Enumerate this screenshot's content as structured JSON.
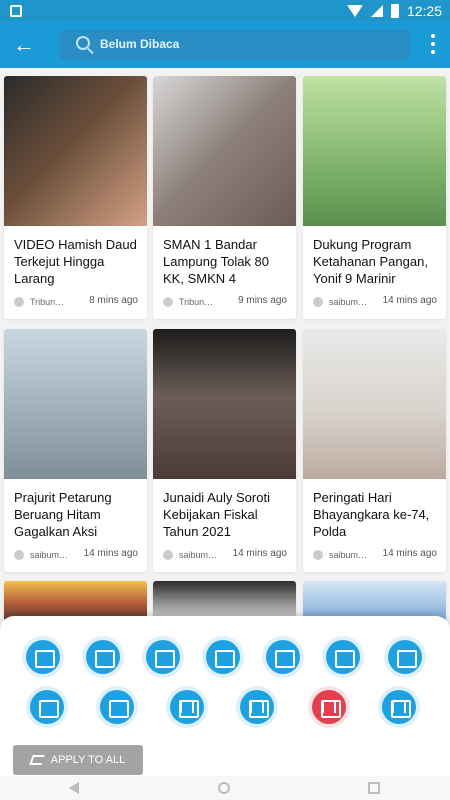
{
  "status_bar": {
    "time": "12:25"
  },
  "app_bar": {
    "search_value": "Belum Dibaca",
    "back_icon": "back-icon",
    "menu_icon": "overflow-menu-icon"
  },
  "cards": [
    {
      "title": "VIDEO Hamish Daud Terkejut Hingga Larang",
      "source": "Tribun…",
      "time": "8 mins ago",
      "thumb_icon": "article-thumbnail"
    },
    {
      "title": "SMAN 1 Bandar Lampung Tolak 80 KK, SMKN 4",
      "source": "Tribun…",
      "time": "9 mins ago",
      "thumb_icon": "article-thumbnail"
    },
    {
      "title": "Dukung Program Ketahanan Pangan, Yonif 9 Marinir",
      "source": "saibum…",
      "time": "14 mins ago",
      "thumb_icon": "article-thumbnail"
    },
    {
      "title": "Prajurit Petarung Beruang Hitam Gagalkan Aksi",
      "source": "saibum…",
      "time": "14 mins ago",
      "thumb_icon": "article-thumbnail"
    },
    {
      "title": "Junaidi Auly Soroti Kebijakan Fiskal Tahun 2021",
      "source": "saibum…",
      "time": "14 mins ago",
      "thumb_icon": "article-thumbnail"
    },
    {
      "title": "Peringati Hari Bhayangkara ke-74, Polda",
      "source": "saibum…",
      "time": "14 mins ago",
      "thumb_icon": "article-thumbnail"
    }
  ],
  "bottom_sheet": {
    "apply_label": "APPLY TO ALL",
    "selected_layout_index": 11,
    "colors": {
      "primary": "#1fa1e1",
      "selected": "#e3404f",
      "appbar": "#1a9ad6"
    }
  }
}
